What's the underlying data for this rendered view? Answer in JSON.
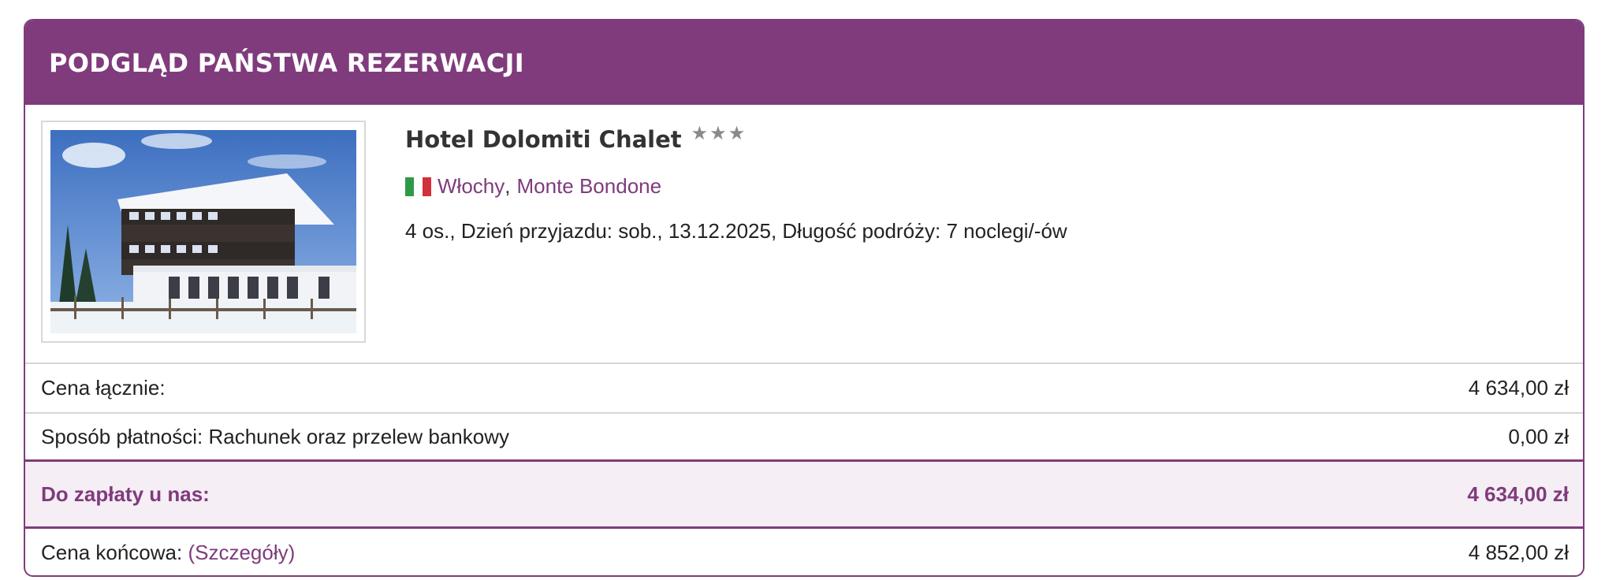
{
  "header": {
    "title": "PODGLĄD PAŃSTWA REZERWACJI"
  },
  "hotel": {
    "name": "Hotel Dolomiti Chalet",
    "stars": "★★★",
    "star_rating": 3,
    "flag_icon": "italy-flag-icon",
    "country": "Włochy",
    "separator": ",",
    "resort": "Monte Bondone",
    "details": "4 os., Dzień przyjazdu: sob., 13.12.2025, Długość podróży: 7 noclegi/-ów"
  },
  "summary": {
    "total_label": "Cena łącznie:",
    "total_value": "4 634,00 zł",
    "payment_label": "Sposób płatności: Rachunek oraz przelew bankowy",
    "payment_value": "0,00 zł",
    "due_label": "Do zapłaty u nas:",
    "due_value": "4 634,00 zł",
    "final_label": "Cena końcowa:",
    "final_link": "(Szczegóły)",
    "final_value": "4 852,00 zł"
  },
  "colors": {
    "accent": "#7f3b7c",
    "due_background": "#f5eef5",
    "star": "#8a8a8a",
    "flag": [
      "#2e9a47",
      "#ffffff",
      "#d2303a"
    ]
  }
}
